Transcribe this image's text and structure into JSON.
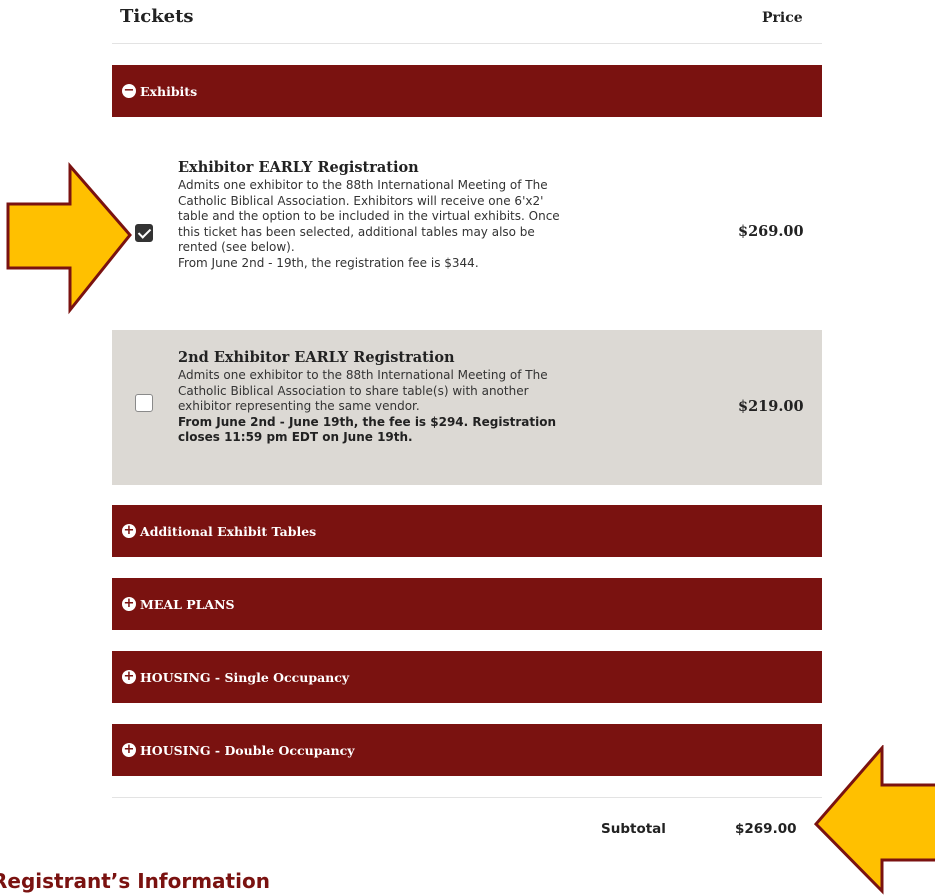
{
  "header": {
    "title": "Tickets",
    "price_col": "Price"
  },
  "categories": {
    "exhibits": {
      "symbol": "−",
      "label": "Exhibits"
    },
    "additional_tables": {
      "symbol": "+",
      "label": "Additional Exhibit Tables"
    },
    "meal_plans": {
      "symbol": "+",
      "label": "MEAL PLANS"
    },
    "housing_single": {
      "symbol": "+",
      "label": "HOUSING - Single Occupancy"
    },
    "housing_double": {
      "symbol": "+",
      "label": "HOUSING - Double Occupancy"
    }
  },
  "tickets": [
    {
      "title": "Exhibitor EARLY Registration",
      "desc1": "Admits one exhibitor to the 88th International Meeting of The Catholic Biblical Association. Exhibitors will receive one 6'x2' table and the option to be included in the virtual exhibits. Once this ticket has been selected, additional tables may also be rented (see below).",
      "desc2": "From June 2nd - 19th, the registration fee is $344.",
      "price": "$269.00",
      "checked": true
    },
    {
      "title": "2nd Exhibitor EARLY Registration",
      "desc1": "Admits one exhibitor to the 88th International Meeting of The Catholic Biblical Association to share table(s) with another exhibitor representing the same vendor.",
      "desc2": "From June 2nd - June 19th, the fee is $294. Registration closes 11:59 pm EDT on June 19th.",
      "price": "$219.00",
      "checked": false
    }
  ],
  "subtotal": {
    "label": "Subtotal",
    "value": "$269.00"
  },
  "next_section": {
    "title": "Registrant’s Information"
  },
  "colors": {
    "band": "#7a1210",
    "shaded_row": "#dcd9d4",
    "arrow_fill": "#ffc000",
    "arrow_stroke": "#7a1210"
  },
  "annotations": [
    {
      "icon": "yellow-arrow-right-icon"
    },
    {
      "icon": "yellow-arrow-left-icon"
    }
  ]
}
